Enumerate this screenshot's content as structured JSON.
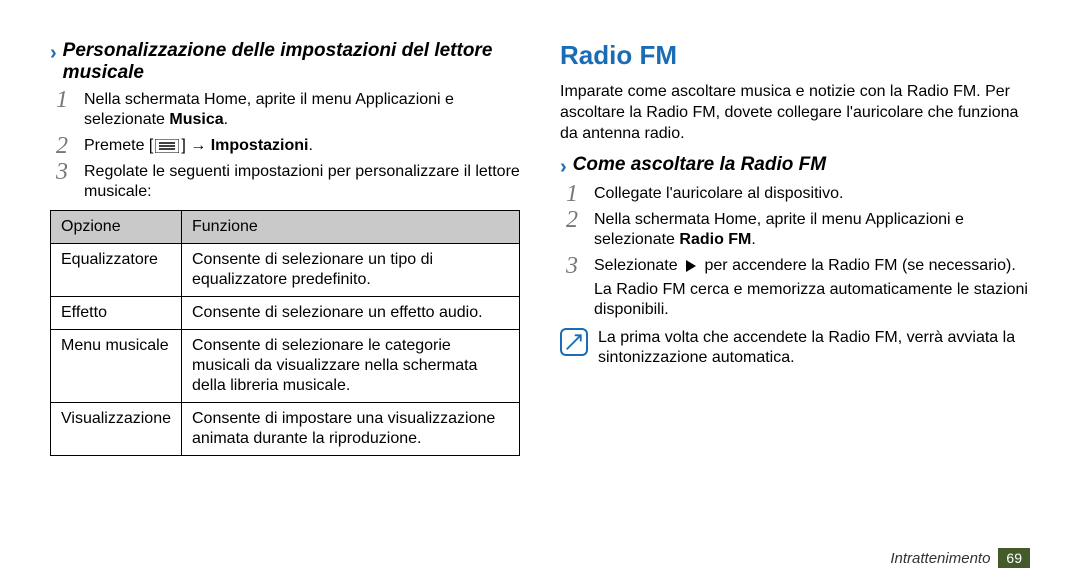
{
  "left": {
    "section_title": "Personalizzazione delle impostazioni del lettore musicale",
    "steps": [
      {
        "pre": "Nella schermata Home, aprite il menu Applicazioni e selezionate ",
        "bold": "Musica",
        "post": "."
      },
      {
        "pre": "Premete [",
        "icon": "menu",
        "mid": "] → ",
        "bold": "Impostazioni",
        "post": "."
      },
      {
        "pre": "Regolate le seguenti impostazioni per personalizzare il lettore musicale:",
        "bold": "",
        "post": ""
      }
    ],
    "table": {
      "headers": [
        "Opzione",
        "Funzione"
      ],
      "rows": [
        [
          "Equalizzatore",
          "Consente di selezionare un tipo di equalizzatore predefinito."
        ],
        [
          "Effetto",
          "Consente di selezionare un effetto audio."
        ],
        [
          "Menu musicale",
          "Consente di selezionare le categorie musicali da visualizzare nella schermata della libreria musicale."
        ],
        [
          "Visualizzazione",
          "Consente di impostare una visualizzazione animata durante la riproduzione."
        ]
      ]
    }
  },
  "right": {
    "main_title": "Radio FM",
    "intro": "Imparate come ascoltare musica e notizie con la Radio FM. Per ascoltare la Radio FM, dovete collegare l'auricolare che funziona da antenna radio.",
    "section_title": "Come ascoltare la Radio FM",
    "steps": [
      {
        "pre": "Collegate l'auricolare al dispositivo.",
        "bold": "",
        "post": ""
      },
      {
        "pre": "Nella schermata Home, aprite il menu Applicazioni e selezionate ",
        "bold": "Radio FM",
        "post": "."
      },
      {
        "pre": "Selezionate ",
        "icon": "play",
        "mid": " per accendere la Radio FM (se necessario).",
        "extra": "La Radio FM cerca e memorizza automaticamente le stazioni disponibili."
      }
    ],
    "note": "La prima volta che accendete la Radio FM, verrà avviata la sintonizzazione automatica."
  },
  "footer": {
    "section": "Intrattenimento",
    "page": "69"
  }
}
